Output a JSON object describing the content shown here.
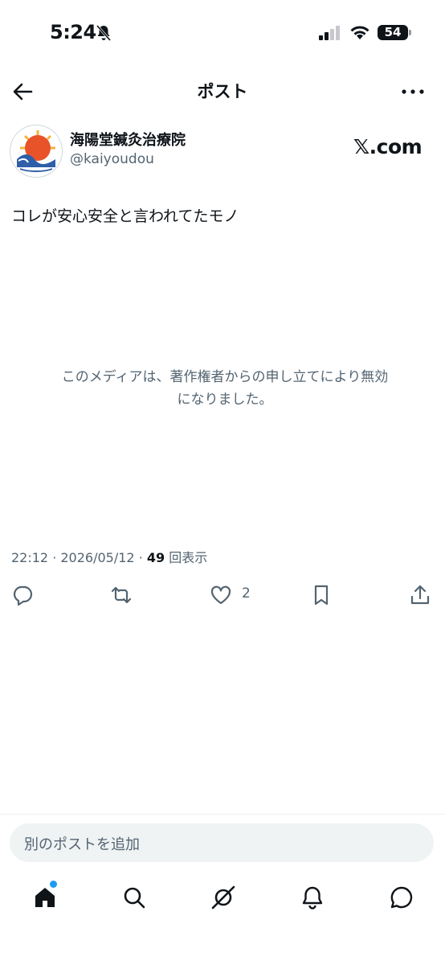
{
  "status_bar": {
    "time": "5:24",
    "battery": "54"
  },
  "header": {
    "title": "ポスト"
  },
  "author": {
    "name": "海陽堂鍼灸治療院",
    "handle": "@kaiyoudou"
  },
  "brand": "𝕏.com",
  "post": {
    "text": "コレが安心安全と言われてたモノ",
    "media_notice_line1": "このメディアは、著作権者からの申し立てにより無効",
    "media_notice_line2": "になりました。",
    "time": "22:12",
    "date": "2026/05/12",
    "views_count": "49",
    "views_label": "回表示"
  },
  "actions": {
    "like_count": "2"
  },
  "composer": {
    "placeholder": "別のポストを追加"
  },
  "colors": {
    "text": "#0f1419",
    "muted": "#536471",
    "accent": "#1d9bf0",
    "field_bg": "#eff3f4"
  }
}
